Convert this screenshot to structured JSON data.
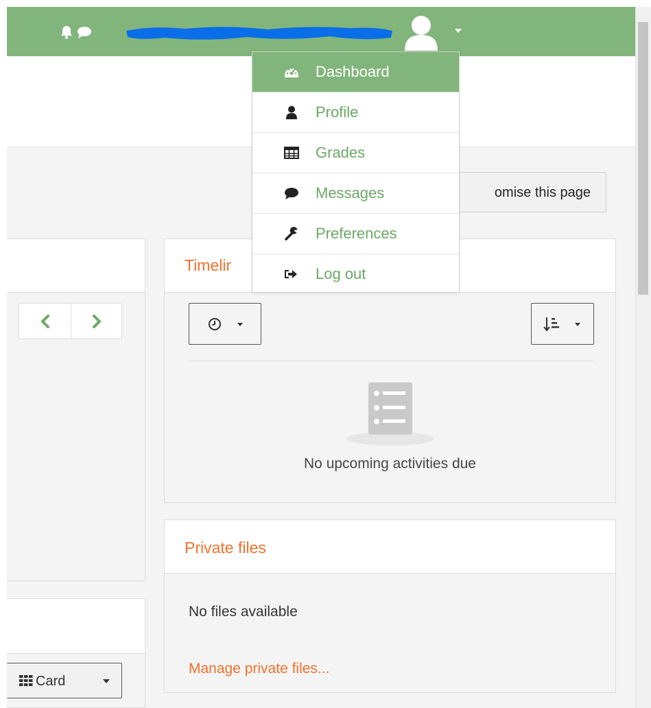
{
  "colors": {
    "brand_green": "#82b57b",
    "link_green": "#6aa964",
    "accent_orange": "#f0722b",
    "redaction_blue": "#0a6ee8"
  },
  "navbar": {
    "icons": [
      "bell-icon",
      "chat-icon",
      "user-avatar-icon",
      "caret-down-icon"
    ],
    "user_name_redacted": true
  },
  "user_menu": {
    "items": [
      {
        "label": "Dashboard",
        "icon": "dashboard-icon",
        "active": true
      },
      {
        "label": "Profile",
        "icon": "user-icon",
        "active": false
      },
      {
        "label": "Grades",
        "icon": "table-icon",
        "active": false
      },
      {
        "label": "Messages",
        "icon": "chat-icon",
        "active": false
      },
      {
        "label": "Preferences",
        "icon": "wrench-icon",
        "active": false
      },
      {
        "label": "Log out",
        "icon": "sign-out-icon",
        "active": false
      }
    ]
  },
  "header": {
    "customise_button_label": "omise this page"
  },
  "timeline": {
    "title": "Timelir",
    "filter_icon": "clock-icon",
    "sort_icon": "sort-icon",
    "empty_icon": "list-icon",
    "empty_message": "No upcoming activities due"
  },
  "private_files": {
    "title": "Private files",
    "empty_message": "No files available",
    "manage_link": "Manage private files..."
  },
  "course_overview": {
    "prev_icon": "chevron-left-icon",
    "next_icon": "chevron-right-icon",
    "view_button_label": "Card",
    "view_button_icon": "grid-icon"
  }
}
